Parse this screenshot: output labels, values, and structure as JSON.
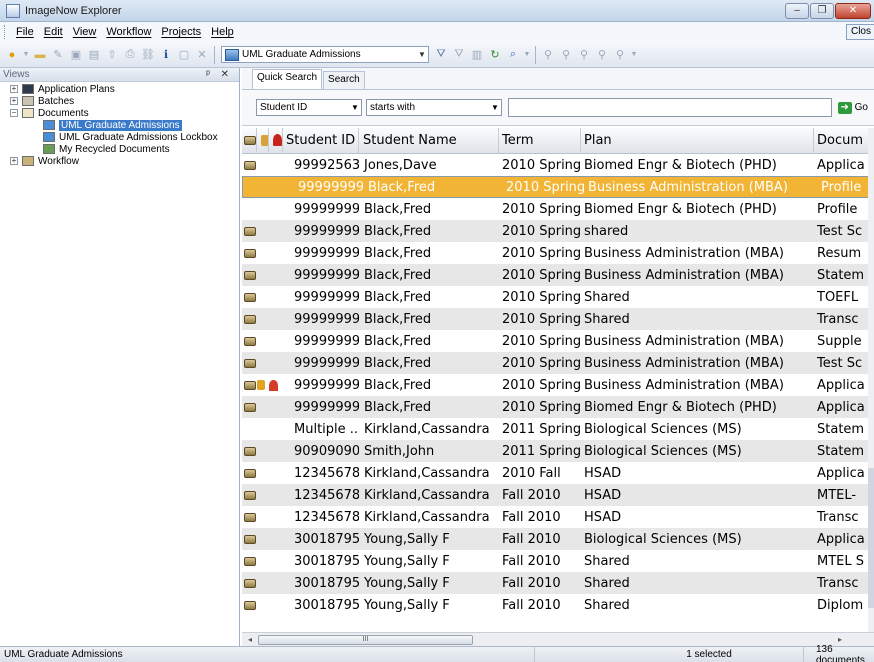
{
  "window": {
    "title": "ImageNow Explorer",
    "minimize": "–",
    "maximize": "❐",
    "close": "✕"
  },
  "menu": [
    "File",
    "Edit",
    "View",
    "Workflow",
    "Projects",
    "Help"
  ],
  "menu_close": "Clos",
  "toolbar": {
    "queue_selected": "UML Graduate Admissions"
  },
  "views": {
    "header": "Views",
    "header_controls": "ᵖ ✕",
    "tree": [
      {
        "label": "Application Plans",
        "level": 0,
        "expander": "+",
        "icon": "binoculars-icon"
      },
      {
        "label": "Batches",
        "level": 0,
        "expander": "+",
        "icon": "batches-icon"
      },
      {
        "label": "Documents",
        "level": 0,
        "expander": "−",
        "icon": "documents-icon"
      },
      {
        "label": "UML Graduate Admissions",
        "level": 1,
        "selected": true,
        "icon": "document-view-icon"
      },
      {
        "label": "UML Graduate Admissions Lockbox",
        "level": 1,
        "icon": "document-view-icon"
      },
      {
        "label": "My Recycled Documents",
        "level": 1,
        "icon": "recycle-icon"
      },
      {
        "label": "Workflow",
        "level": 0,
        "expander": "+",
        "icon": "workflow-icon"
      }
    ]
  },
  "search": {
    "tabs": [
      "Quick Search",
      "Search"
    ],
    "field_select": "Student ID",
    "operator_select": "starts with",
    "value": "",
    "go_label": "Go"
  },
  "grid": {
    "columns": [
      "Student ID",
      "Student Name",
      "Term",
      "Plan",
      "Docum"
    ],
    "rows": [
      {
        "id": "99992563",
        "name": "Jones,Dave",
        "term": "2010 Spring",
        "plan": "Biomed Engr & Biotech (PHD)",
        "doc": "Applica",
        "doc_icon": true
      },
      {
        "id": "99999999",
        "name": "Black,Fred",
        "term": "2010 Spring",
        "plan": "Business Administration (MBA)",
        "doc": "Profile",
        "doc_icon": false,
        "selected": true
      },
      {
        "id": "99999999",
        "name": "Black,Fred",
        "term": "2010 Spring",
        "plan": "Biomed Engr & Biotech (PHD)",
        "doc": "Profile",
        "doc_icon": false
      },
      {
        "id": "99999999",
        "name": "Black,Fred",
        "term": "2010 Spring",
        "plan": "shared",
        "doc": "Test Sc",
        "doc_icon": true
      },
      {
        "id": "99999999",
        "name": "Black,Fred",
        "term": "2010 Spring",
        "plan": "Business Administration (MBA)",
        "doc": "Resum",
        "doc_icon": true
      },
      {
        "id": "99999999",
        "name": "Black,Fred",
        "term": "2010 Spring",
        "plan": "Business Administration (MBA)",
        "doc": "Statem",
        "doc_icon": true
      },
      {
        "id": "99999999",
        "name": "Black,Fred",
        "term": "2010 Spring",
        "plan": "Shared",
        "doc": "TOEFL",
        "doc_icon": true
      },
      {
        "id": "99999999",
        "name": "Black,Fred",
        "term": "2010 Spring",
        "plan": "Shared",
        "doc": "Transc",
        "doc_icon": true
      },
      {
        "id": "99999999",
        "name": "Black,Fred",
        "term": "2010 Spring",
        "plan": "Business Administration (MBA)",
        "doc": "Supple",
        "doc_icon": true
      },
      {
        "id": "99999999",
        "name": "Black,Fred",
        "term": "2010 Spring",
        "plan": "Business Administration (MBA)",
        "doc": "Test Sc",
        "doc_icon": true
      },
      {
        "id": "99999999",
        "name": "Black,Fred",
        "term": "2010 Spring",
        "plan": "Business Administration (MBA)",
        "doc": "Applica",
        "doc_icon": true,
        "lock": true,
        "flag": true
      },
      {
        "id": "99999999",
        "name": "Black,Fred",
        "term": "2010 Spring",
        "plan": "Biomed Engr & Biotech (PHD)",
        "doc": "Applica",
        "doc_icon": true
      },
      {
        "id": "Multiple ...",
        "name": "Kirkland,Cassandra",
        "term": "2011 Spring",
        "plan": "Biological Sciences (MS)",
        "doc": "Statem",
        "doc_icon": false
      },
      {
        "id": "90909090",
        "name": "Smith,John",
        "term": "2011 Spring",
        "plan": "Biological Sciences (MS)",
        "doc": "Statem",
        "doc_icon": true
      },
      {
        "id": "12345678",
        "name": "Kirkland,Cassandra",
        "term": "2010 Fall",
        "plan": "HSAD",
        "doc": "Applica",
        "doc_icon": true
      },
      {
        "id": "12345678",
        "name": "Kirkland,Cassandra",
        "term": "Fall 2010",
        "plan": "HSAD",
        "doc": "MTEL-",
        "doc_icon": true
      },
      {
        "id": "12345678",
        "name": "Kirkland,Cassandra",
        "term": "Fall 2010",
        "plan": "HSAD",
        "doc": "Transc",
        "doc_icon": true
      },
      {
        "id": "30018795",
        "name": "Young,Sally F",
        "term": "Fall 2010",
        "plan": "Biological Sciences (MS)",
        "doc": "Applica",
        "doc_icon": true
      },
      {
        "id": "30018795",
        "name": "Young,Sally F",
        "term": "Fall 2010",
        "plan": "Shared",
        "doc": "MTEL S",
        "doc_icon": true
      },
      {
        "id": "30018795",
        "name": "Young,Sally F",
        "term": "Fall 2010",
        "plan": "Shared",
        "doc": "Transc",
        "doc_icon": true
      },
      {
        "id": "30018795",
        "name": "Young,Sally F",
        "term": "Fall 2010",
        "plan": "Shared",
        "doc": "Diplom",
        "doc_icon": true
      }
    ],
    "scroll_grip": "III"
  },
  "status": {
    "left": "UML Graduate Admissions",
    "middle": "1 selected",
    "right": "136 documents"
  },
  "colors": {
    "selection": "#f1b434",
    "tree_selection": "#3a7ac8",
    "alt_row": "#e7e7e7"
  }
}
